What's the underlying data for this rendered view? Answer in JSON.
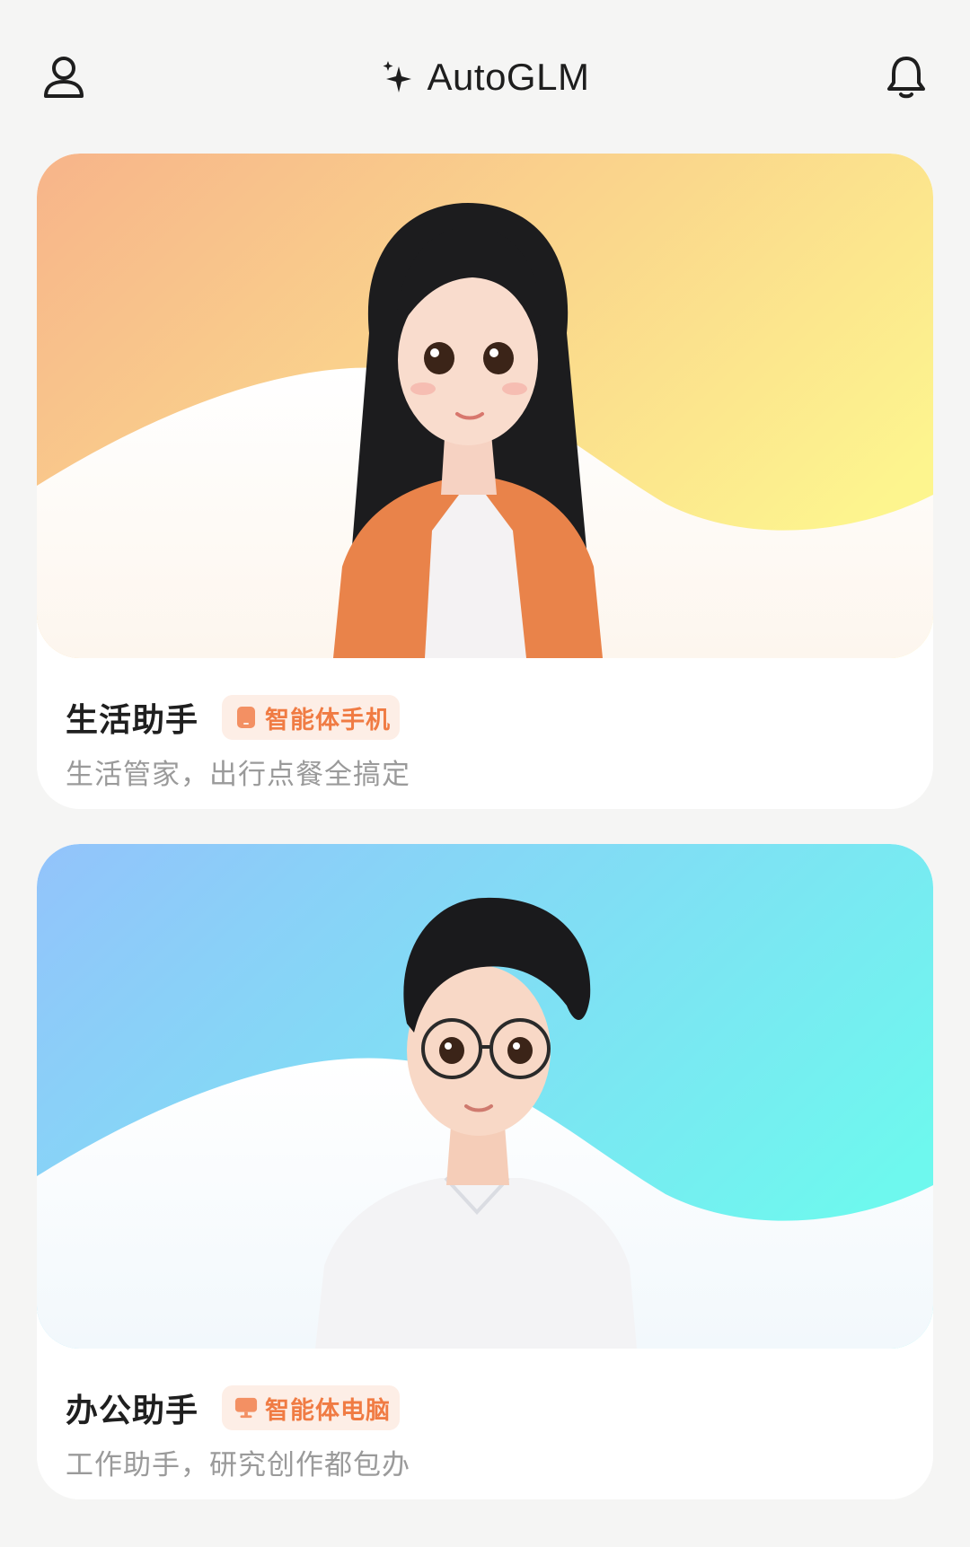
{
  "header": {
    "title": "AutoGLM",
    "profile_icon": "user-icon",
    "notification_icon": "bell-icon",
    "logo_icon": "sparkle-icon"
  },
  "assistants": [
    {
      "title": "生活助手",
      "tag_label": "智能体手机",
      "tag_icon": "phone-icon",
      "description": "生活管家，出行点餐全搞定",
      "avatar": "female-avatar-orange-jacket",
      "gradient": [
        "#f7b48a",
        "#fdf58e"
      ]
    },
    {
      "title": "办公助手",
      "tag_label": "智能体电脑",
      "tag_icon": "monitor-icon",
      "description": "工作助手，研究创作都包办",
      "avatar": "male-avatar-glasses",
      "gradient": [
        "#93c3fb",
        "#6ef8ee"
      ]
    }
  ],
  "colors": {
    "background": "#f5f5f4",
    "card": "#ffffff",
    "tag_bg": "#fdeee6",
    "tag_text": "#f07b43",
    "title_text": "#1f1f1f",
    "desc_text": "#9a9a9a"
  }
}
